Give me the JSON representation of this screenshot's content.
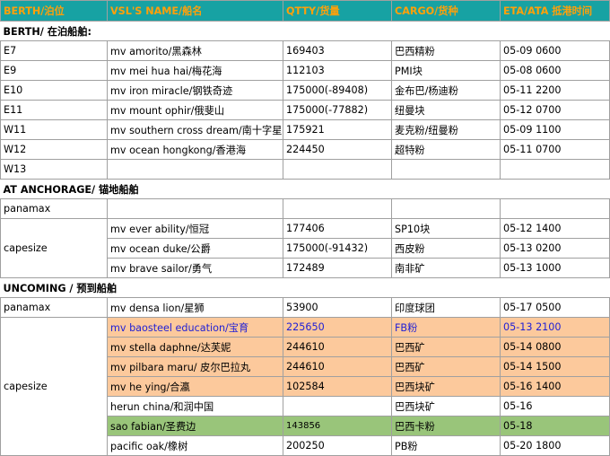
{
  "headers": [
    "BERTH/泊位",
    "VSL'S NAME/船名",
    "QTTY/货量",
    "CARGO/货种",
    "ETA/ATA 抵港时间"
  ],
  "colors": {
    "header_bg": "#17a2a3",
    "header_text": "#ffa00a",
    "orange_row": "#fcc99c",
    "green_row": "#99c57a",
    "blue_text": "#1f1fd6"
  },
  "sections": {
    "berth": "BERTH/ 在泊船舶:",
    "anchorage": "AT ANCHORAGE/ 锚地船舶",
    "incoming": "UNCOMING / 预到船舶"
  },
  "berth_rows": [
    {
      "berth": "E7",
      "name": "mv amorito/黑森林",
      "qty": "169403",
      "cargo": "巴西精粉",
      "eta": "05-09 0600"
    },
    {
      "berth": "E9",
      "name": "mv mei hua hai/梅花海",
      "qty": "112103",
      "cargo": "PMI块",
      "eta": "05-08 0600"
    },
    {
      "berth": "E10",
      "name": "mv iron miracle/钢铁奇迹",
      "qty": "175000(-89408)",
      "cargo": "金布巴/杨迪粉",
      "eta": "05-11 2200"
    },
    {
      "berth": "E11",
      "name": "mv mount ophir/俄斐山",
      "qty": "175000(-77882)",
      "cargo": "纽曼块",
      "eta": "05-12 0700"
    },
    {
      "berth": "W11",
      "name": "mv southern cross dream/南十字星",
      "qty": "175921",
      "cargo": "麦克粉/纽曼粉",
      "eta": "05-09 1100"
    },
    {
      "berth": "W12",
      "name": "mv ocean hongkong/香港海",
      "qty": "224450",
      "cargo": "超特粉",
      "eta": "05-11 0700"
    },
    {
      "berth": "W13",
      "name": "",
      "qty": "",
      "cargo": "",
      "eta": ""
    }
  ],
  "anchorage": {
    "panamax_label": "panamax",
    "capesize_label": "capesize",
    "capesize_rows": [
      {
        "name": "mv ever ability/恒冠",
        "qty": "177406",
        "cargo": "SP10块",
        "eta": "05-12 1400"
      },
      {
        "name": "mv ocean duke/公爵",
        "qty": "175000(-91432)",
        "cargo": "西皮粉",
        "eta": "05-13 0200"
      },
      {
        "name": "mv brave sailor/勇气",
        "qty": "172489",
        "cargo": "南非矿",
        "eta": "05-13 1000"
      }
    ]
  },
  "incoming": {
    "panamax_label": "panamax",
    "panamax_row": {
      "name": "mv densa lion/星狮",
      "qty": "53900",
      "cargo": "印度球团",
      "eta": "05-17 0500"
    },
    "capesize_label": "capesize",
    "capesize_rows": [
      {
        "name": "mv baosteel education/宝育",
        "qty": "225650",
        "cargo": "FB粉",
        "eta": "05-13 2100"
      },
      {
        "name": "mv stella daphne/达芙妮",
        "qty": "244610",
        "cargo": "巴西矿",
        "eta": "05-14 0800"
      },
      {
        "name": "mv pilbara maru/ 皮尔巴拉丸",
        "qty": "244610",
        "cargo": "巴西矿",
        "eta": "05-14 1500"
      },
      {
        "name": "mv he ying/合瀛",
        "qty": "102584",
        "cargo": "巴西块矿",
        "eta": "05-16 1400"
      },
      {
        "name": "herun china/和润中国",
        "qty": "",
        "cargo": "巴西块矿",
        "eta": "05-16"
      },
      {
        "name": "sao fabian/圣费边",
        "qty": "143856",
        "cargo": "巴西卡粉",
        "eta": "05-18"
      },
      {
        "name": "pacific oak/橡树",
        "qty": "200250",
        "cargo": "PB粉",
        "eta": "05-20 1800"
      }
    ]
  }
}
